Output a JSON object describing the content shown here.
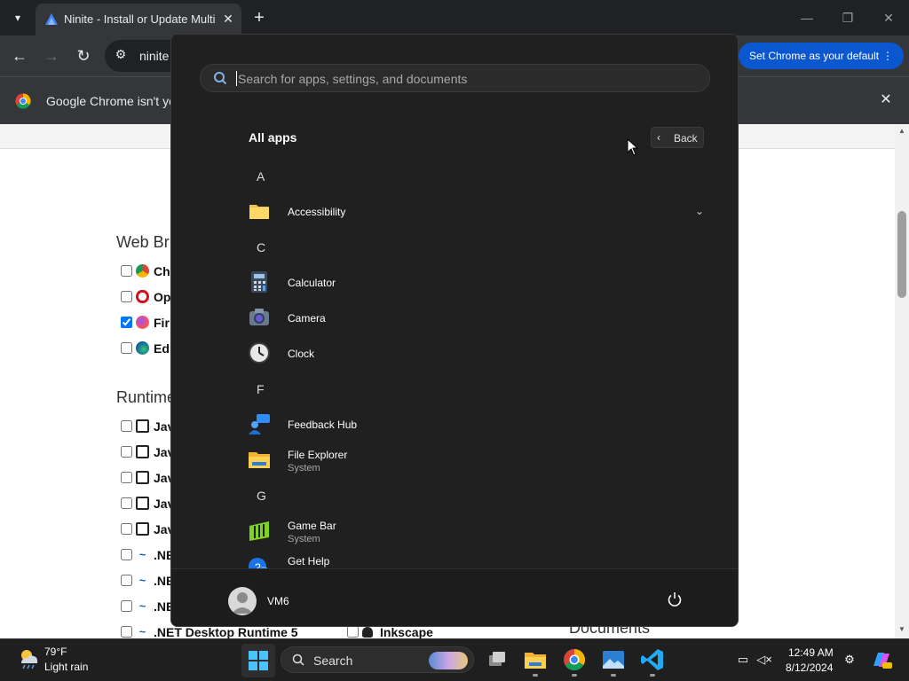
{
  "browser": {
    "tab_title": "Ninite - Install or Update Multip",
    "tab_close": "✕",
    "new_tab": "+",
    "url": "ninite",
    "default_button": "Set Chrome as your default",
    "default_button_menu": "⋮",
    "infobar_text": "Google Chrome isn't you",
    "infobar_close": "✕",
    "window_controls": {
      "minimize": "—",
      "maximize": "❐",
      "close": "✕"
    }
  },
  "page": {
    "sections": [
      {
        "heading": "Web Br"
      },
      {
        "heading": "Runtime"
      },
      {
        "heading": "Documents"
      }
    ],
    "web_browsers": [
      {
        "label": "Ch",
        "checked": false,
        "icon": "chrome-icon"
      },
      {
        "label": "Op",
        "checked": false,
        "icon": "opera-icon"
      },
      {
        "label": "Fir",
        "checked": true,
        "icon": "firefox-icon"
      },
      {
        "label": "Ed",
        "checked": false,
        "icon": "edge-icon"
      }
    ],
    "runtimes": [
      {
        "label": "Jav",
        "checked": false
      },
      {
        "label": "Jav",
        "checked": false
      },
      {
        "label": "Jav",
        "checked": false
      },
      {
        "label": "Jav",
        "checked": false
      },
      {
        "label": "Jav",
        "checked": false
      },
      {
        "label": ".NE",
        "checked": false
      },
      {
        "label": ".NE",
        "checked": false
      },
      {
        "label": ".NE",
        "checked": false
      },
      {
        "label": ".NET Desktop Runtime 5",
        "checked": false
      }
    ],
    "imaging_partial": {
      "label": "Inkscape",
      "checked": false
    }
  },
  "start_menu": {
    "search_placeholder": "Search for apps, settings, and documents",
    "title": "All apps",
    "back_label": "Back",
    "groups": [
      {
        "letter": "A",
        "apps": [
          {
            "name": "Accessibility",
            "sub": "",
            "icon": "folder-icon",
            "expandable": true
          }
        ]
      },
      {
        "letter": "C",
        "apps": [
          {
            "name": "Calculator",
            "sub": "",
            "icon": "calculator-icon"
          },
          {
            "name": "Camera",
            "sub": "",
            "icon": "camera-icon"
          },
          {
            "name": "Clock",
            "sub": "",
            "icon": "clock-icon"
          }
        ]
      },
      {
        "letter": "F",
        "apps": [
          {
            "name": "Feedback Hub",
            "sub": "",
            "icon": "feedback-hub-icon"
          },
          {
            "name": "File Explorer",
            "sub": "System",
            "icon": "file-explorer-icon"
          }
        ]
      },
      {
        "letter": "G",
        "apps": [
          {
            "name": "Game Bar",
            "sub": "System",
            "icon": "game-bar-icon"
          },
          {
            "name": "Get Help",
            "sub": "",
            "icon": "get-help-icon"
          }
        ]
      }
    ],
    "user_name": "VM6"
  },
  "taskbar": {
    "weather_temp": "79°F",
    "weather_desc": "Light rain",
    "search_label": "Search",
    "pinned": [
      "task-view-icon",
      "file-explorer-icon",
      "chrome-icon",
      "photos-icon",
      "vscode-icon"
    ],
    "time": "12:49 AM",
    "date": "8/12/2024"
  },
  "colors": {
    "start_bg": "#202020",
    "chrome_accent": "#0b57d0",
    "taskbar_bg": "#1f1f1f"
  }
}
